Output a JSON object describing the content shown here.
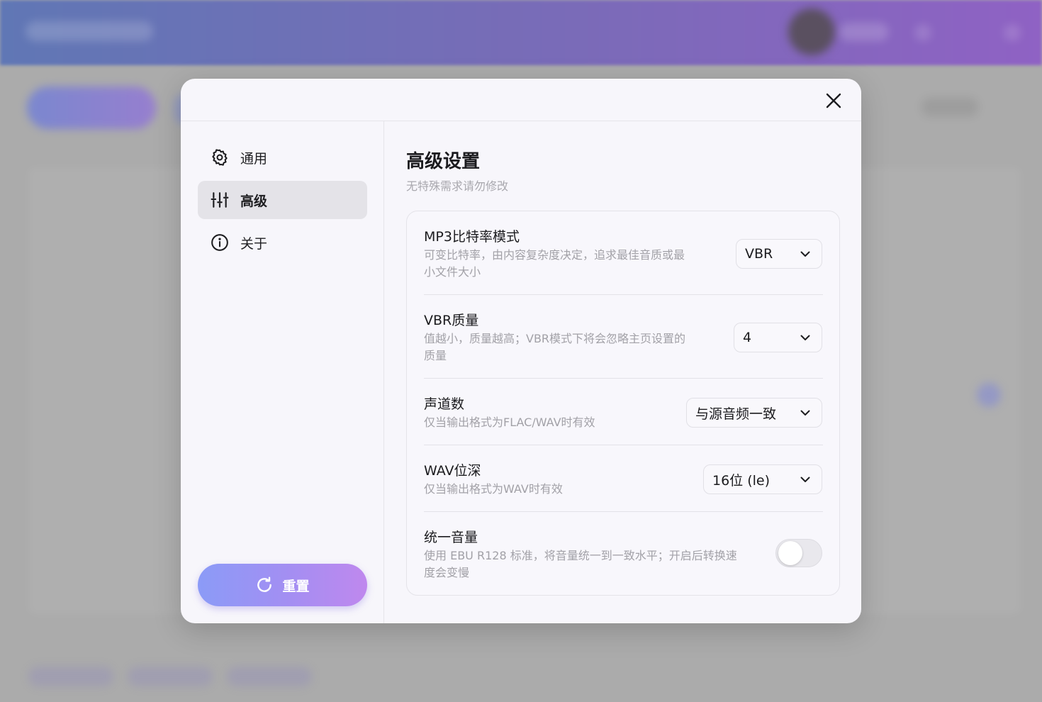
{
  "dialog": {
    "close_icon": "close-icon"
  },
  "sidebar": {
    "items": [
      {
        "label": "通用",
        "icon": "gear-icon",
        "active": false
      },
      {
        "label": "高级",
        "icon": "sliders-icon",
        "active": true
      },
      {
        "label": "关于",
        "icon": "info-icon",
        "active": false
      }
    ],
    "reset_label": "重置",
    "reset_icon": "refresh-icon"
  },
  "content": {
    "title": "高级设置",
    "subtitle": "无特殊需求请勿修改",
    "settings": [
      {
        "title": "MP3比特率模式",
        "desc_line1": "可变比特率，由内容复杂度决定，追求最佳音质或最",
        "desc_line2": "小文件大小",
        "value": "VBR"
      },
      {
        "title": "VBR质量",
        "desc_line1": "值越小，质量越高；VBR模式下将会忽略主页设置的",
        "desc_line2": "质量",
        "value": "4"
      },
      {
        "title": "声道数",
        "desc_line1": "仅当输出格式为FLAC/WAV时有效",
        "value": "与源音频一致"
      },
      {
        "title": "WAV位深",
        "desc_line1": "仅当输出格式为WAV时有效",
        "value": "16位 (le)"
      },
      {
        "title": "统一音量",
        "desc_line1": "使用 EBU R128 标准，将音量统一到一致水平；开启后转换速",
        "desc_line2": "度会变慢",
        "enabled": false
      }
    ]
  },
  "colors": {
    "accent_start": "#8b9bf7",
    "accent_end": "#bf88ee",
    "header_gradient_start": "#6077b5",
    "header_gradient_end": "#8f62c4"
  }
}
